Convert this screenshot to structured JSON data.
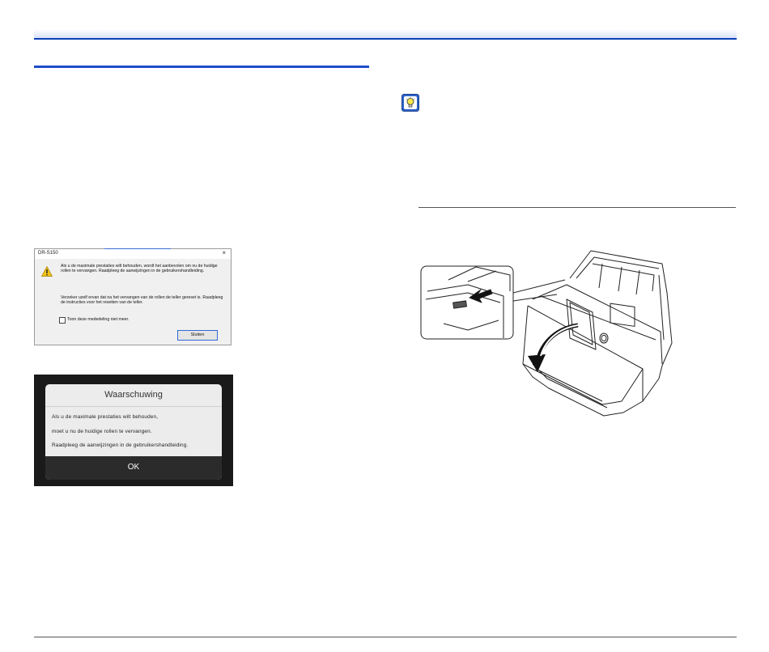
{
  "win_dialog": {
    "title": "DR-S150",
    "close_label": "×",
    "message": "Als u de maximale prestaties wilt behouden, wordt het aanbevolen om nu de huidige rollen te vervangen. Raadpleeg de aanwijzingen in de gebruikershandleiding.",
    "message2": "Verzeker uzelf ervan dat na het vervangen van de rollen de teller gereset is. Raadpleeg de instructies voor het resetten van de teller.",
    "checkbox_label": "Toon deze mededeling niet meer.",
    "button_label": "Sluiten"
  },
  "panel": {
    "title": "Waarschuwing",
    "lines": [
      "Als u de maximale prestaties wilt behouden,",
      "moet u nu de huidige rollen te vervangen.",
      "Raadpleeg de aanwijzingen in de gebruikershandleiding."
    ],
    "ok_label": "OK"
  },
  "icons": {
    "hint": "lightbulb-icon",
    "warning": "warning-icon"
  },
  "colors": {
    "accent": "#1d4fc9",
    "rule": "#0b3fb8"
  }
}
